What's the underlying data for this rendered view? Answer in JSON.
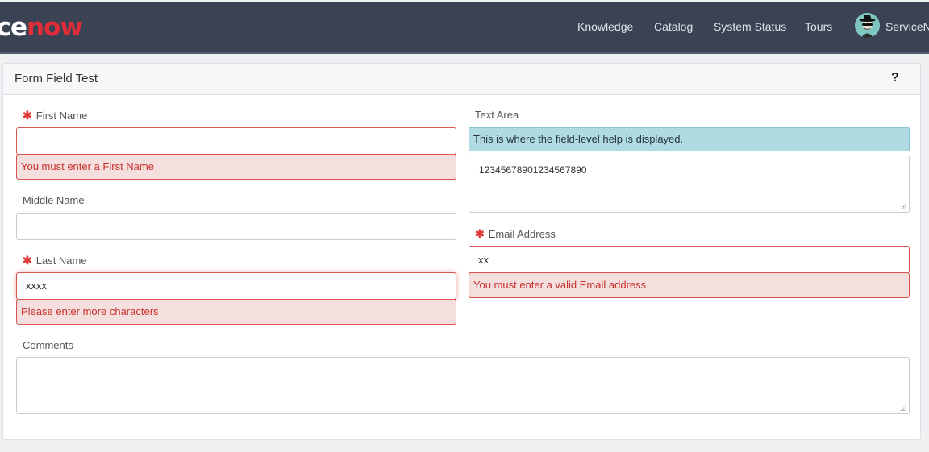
{
  "header": {
    "logo": {
      "white": "ce",
      "red": "now"
    },
    "nav": [
      "Knowledge",
      "Catalog",
      "System Status",
      "Tours"
    ],
    "user": {
      "name": "ServiceNow",
      "avatar": "spy-avatar-icon"
    }
  },
  "panel": {
    "title": "Form Field Test",
    "help_icon": "?"
  },
  "fields": {
    "first_name": {
      "label": "First Name",
      "required": true,
      "value": "",
      "error": "You must enter a First Name"
    },
    "middle_name": {
      "label": "Middle Name",
      "required": false,
      "value": ""
    },
    "last_name": {
      "label": "Last Name",
      "required": true,
      "value": "xxxx",
      "error": "Please enter more characters"
    },
    "comments": {
      "label": "Comments",
      "value": ""
    },
    "text_area": {
      "label": "Text Area",
      "help": "This is where the field-level help is displayed.",
      "value": "12345678901234567890"
    },
    "email": {
      "label": "Email Address",
      "required": true,
      "value": "xx",
      "error": "You must enter a valid Email address"
    }
  },
  "required_marker": "✱",
  "colors": {
    "topbar": "#3b4254",
    "logo_red": "#e12d39",
    "error_text": "#c9302c",
    "error_bg": "#f4dede",
    "help_bg": "#b1dbe3"
  }
}
